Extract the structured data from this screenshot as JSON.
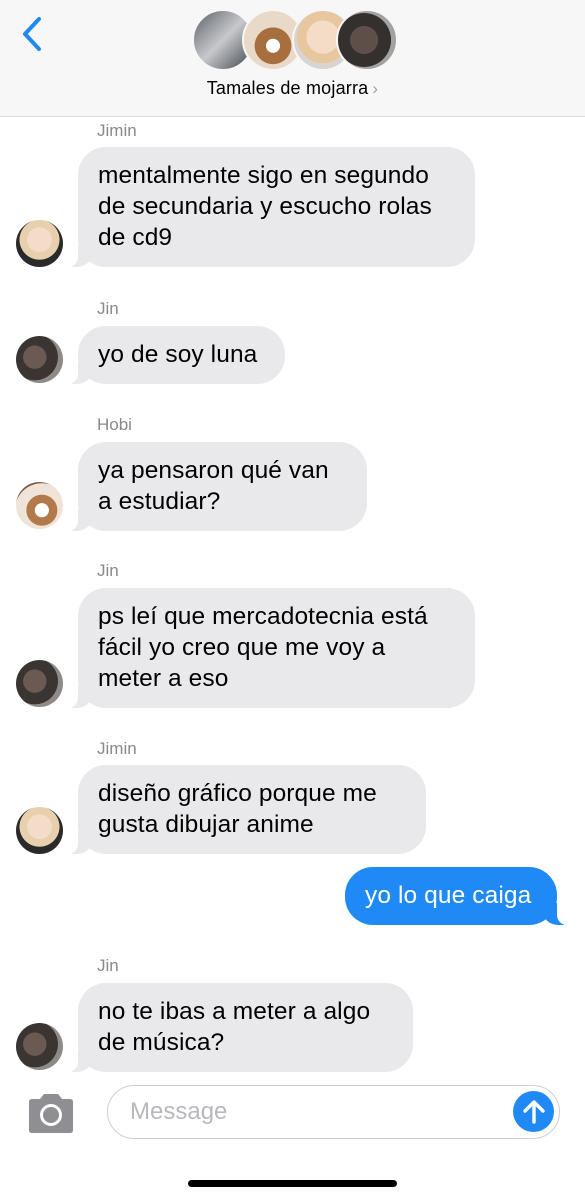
{
  "header": {
    "back_icon": "chevron-left-icon",
    "group_name": "Tamales de mojarra",
    "chevron": "›",
    "accent_color": "#1f8af6"
  },
  "messages": [
    {
      "sender": "Jimin",
      "text": "mentalmente sigo en segundo\nde secundaria y escucho rolas\nde cd9",
      "direction": "received"
    },
    {
      "sender": "Jin",
      "text": "yo de soy luna",
      "direction": "received"
    },
    {
      "sender": "Hobi",
      "text": "ya pensaron qué van\na estudiar?",
      "direction": "received"
    },
    {
      "sender": "Jin",
      "text": "ps leí que mercadotecnia está\nfácil yo creo que me voy a\nmeter a eso",
      "direction": "received"
    },
    {
      "sender": "Jimin",
      "text": "diseño gráfico porque me\ngusta dibujar anime",
      "direction": "received"
    },
    {
      "sender": "",
      "text": "yo lo que caiga",
      "direction": "sent"
    },
    {
      "sender": "Jin",
      "text": "no te ibas a meter a algo\nde música?",
      "direction": "received"
    }
  ],
  "composer": {
    "placeholder": "Message",
    "camera_icon": "camera-icon",
    "send_icon": "arrow-up-icon"
  },
  "colors": {
    "received_bubble": "#e9e9eb",
    "sent_bubble": "#1f8af6",
    "sender_label": "#8a8a8e"
  }
}
